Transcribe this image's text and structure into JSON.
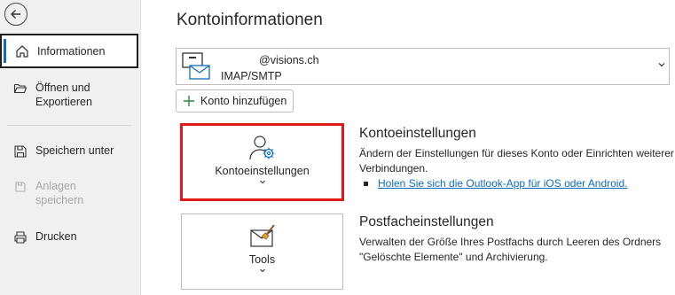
{
  "sidebar": {
    "back_icon": "back-arrow-icon",
    "items": [
      {
        "label": "Informationen",
        "icon": "home-icon",
        "active": true
      },
      {
        "label": "Öffnen und Exportieren",
        "line1": "Öffnen und",
        "line2": "Exportieren",
        "icon": "folder-open-icon"
      },
      {
        "label": "Speichern unter",
        "icon": "save-as-icon"
      },
      {
        "label": "Anlagen speichern",
        "line1": "Anlagen",
        "line2": "speichern",
        "icon": "save-attachments-icon",
        "disabled": true
      },
      {
        "label": "Drucken",
        "icon": "printer-icon"
      }
    ]
  },
  "main": {
    "title": "Kontoinformationen",
    "account": {
      "email": "@visions.ch",
      "type": "IMAP/SMTP",
      "icon": "mail-account-icon"
    },
    "add_account_label": "Konto hinzufügen",
    "sections": [
      {
        "tile_label": "Kontoeinstellungen",
        "tile_icon": "account-settings-icon",
        "title": "Kontoeinstellungen",
        "description": "Ändern der Einstellungen für dieses Konto oder Einrichten weiterer Verbindungen.",
        "link": "Holen Sie sich die Outlook-App für iOS oder Android."
      },
      {
        "tile_label": "Tools",
        "tile_icon": "mailbox-cleanup-icon",
        "title": "Postfacheinstellungen",
        "description": "Verwalten der Größe Ihres Postfachs durch Leeren des Ordners \"Gelöschte Elemente\" und Archivierung."
      }
    ]
  },
  "colors": {
    "accent": "#0f6cbd",
    "highlight": "#e01919",
    "sidebar_bg": "#f0f0f0"
  }
}
